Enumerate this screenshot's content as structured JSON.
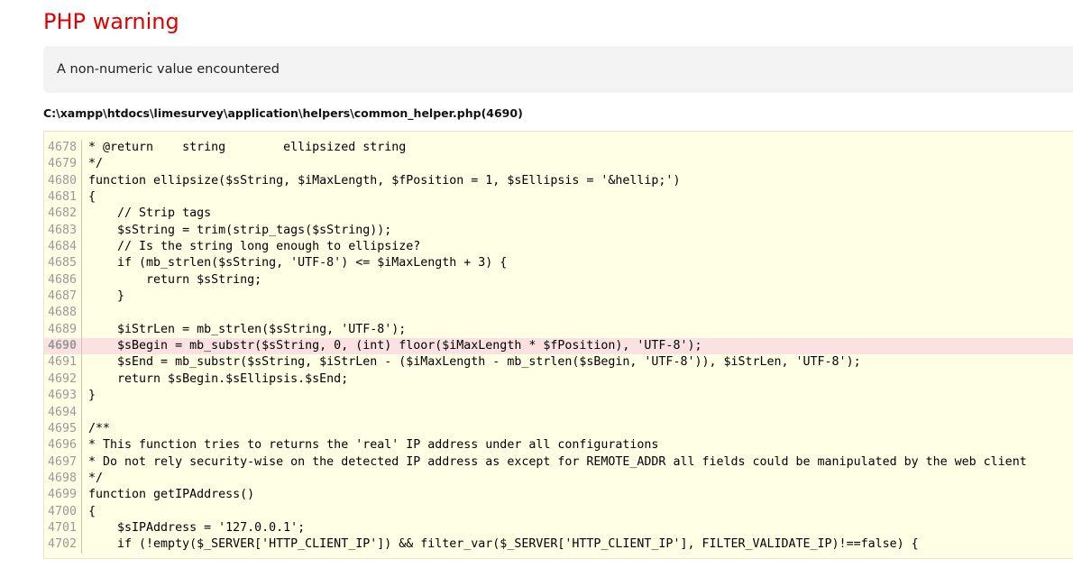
{
  "error": {
    "title": "PHP warning",
    "message": "A non-numeric value encountered",
    "file": "C:\\xampp\\htdocs\\limesurvey\\application\\helpers\\common_helper.php(4690)",
    "highlight_line": 4690
  },
  "source": {
    "lines": [
      {
        "num": "4678",
        "code": "* @return    string        ellipsized string"
      },
      {
        "num": "4679",
        "code": "*/"
      },
      {
        "num": "4680",
        "code": "function ellipsize($sString, $iMaxLength, $fPosition = 1, $sEllipsis = '&hellip;')"
      },
      {
        "num": "4681",
        "code": "{"
      },
      {
        "num": "4682",
        "code": "    // Strip tags"
      },
      {
        "num": "4683",
        "code": "    $sString = trim(strip_tags($sString));"
      },
      {
        "num": "4684",
        "code": "    // Is the string long enough to ellipsize?"
      },
      {
        "num": "4685",
        "code": "    if (mb_strlen($sString, 'UTF-8') <= $iMaxLength + 3) {"
      },
      {
        "num": "4686",
        "code": "        return $sString;"
      },
      {
        "num": "4687",
        "code": "    }"
      },
      {
        "num": "4688",
        "code": ""
      },
      {
        "num": "4689",
        "code": "    $iStrLen = mb_strlen($sString, 'UTF-8');"
      },
      {
        "num": "4690",
        "code": "    $sBegin = mb_substr($sString, 0, (int) floor($iMaxLength * $fPosition), 'UTF-8');"
      },
      {
        "num": "4691",
        "code": "    $sEnd = mb_substr($sString, $iStrLen - ($iMaxLength - mb_strlen($sBegin, 'UTF-8')), $iStrLen, 'UTF-8');"
      },
      {
        "num": "4692",
        "code": "    return $sBegin.$sEllipsis.$sEnd;"
      },
      {
        "num": "4693",
        "code": "}"
      },
      {
        "num": "4694",
        "code": ""
      },
      {
        "num": "4695",
        "code": "/**"
      },
      {
        "num": "4696",
        "code": "* This function tries to returns the 'real' IP address under all configurations"
      },
      {
        "num": "4697",
        "code": "* Do not rely security-wise on the detected IP address as except for REMOTE_ADDR all fields could be manipulated by the web client"
      },
      {
        "num": "4698",
        "code": "*/"
      },
      {
        "num": "4699",
        "code": "function getIPAddress()"
      },
      {
        "num": "4700",
        "code": "{"
      },
      {
        "num": "4701",
        "code": "    $sIPAddress = '127.0.0.1';"
      },
      {
        "num": "4702",
        "code": "    if (!empty($_SERVER['HTTP_CLIENT_IP']) && filter_var($_SERVER['HTTP_CLIENT_IP'], FILTER_VALIDATE_IP)!==false) {"
      }
    ]
  }
}
